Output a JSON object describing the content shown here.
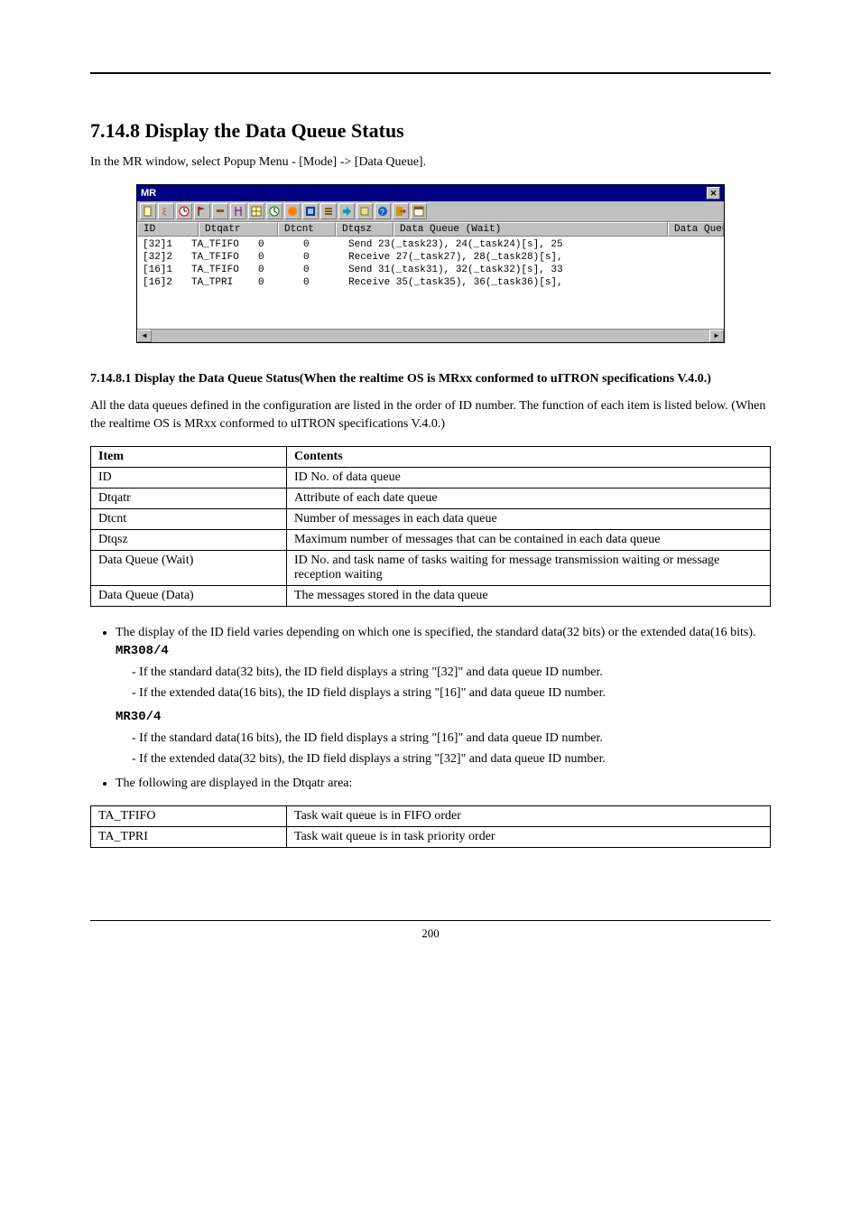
{
  "section_number": "7.14.8",
  "section_title": "Display the Data Queue Status",
  "intro_paragraph": "In the MR window, select Popup Menu - [Mode] -> [Data Queue].",
  "mr_window": {
    "title": "MR",
    "columns": [
      "ID",
      "Dtqatr",
      "Dtcnt",
      "Dtqsz",
      "Data Queue (Wait)",
      "Data Queue (Data)"
    ],
    "rows": [
      {
        "id": "[32]1",
        "attr": "TA_TFIFO",
        "dtcnt": "0",
        "dtqsz": "0",
        "wait": "Send 23(_task23), 24(_task24)[s], 25",
        "data": ""
      },
      {
        "id": "[32]2",
        "attr": "TA_TFIFO",
        "dtcnt": "0",
        "dtqsz": "0",
        "wait": "Receive 27(_task27), 28(_task28)[s],",
        "data": ""
      },
      {
        "id": "[16]1",
        "attr": "TA_TFIFO",
        "dtcnt": "0",
        "dtqsz": "0",
        "wait": "Send 31(_task31), 32(_task32)[s], 33",
        "data": ""
      },
      {
        "id": "[16]2",
        "attr": "TA_TPRI",
        "dtcnt": "0",
        "dtqsz": "0",
        "wait": "Receive 35(_task35), 36(_task36)[s],",
        "data": ""
      }
    ]
  },
  "subsection_number": "7.14.8.1",
  "subsection_title": "Display the Data Queue Status(When the realtime OS is MRxx conformed to uITRON specifications V.4.0.)",
  "subsection_para": "All the data queues defined in the configuration are listed in the order of ID number. The function of each item is listed below. (When the realtime OS is MRxx conformed to uITRON specifications V.4.0.)",
  "items_table": {
    "headers": [
      "Item",
      "Contents"
    ],
    "rows": [
      [
        "ID",
        "ID No. of data queue"
      ],
      [
        "Dtqatr",
        "Attribute of each date queue"
      ],
      [
        "Dtcnt",
        "Number of messages in each data queue"
      ],
      [
        "Dtqsz",
        "Maximum number of messages that can be contained in each data queue"
      ],
      [
        "Data Queue (Wait)",
        "ID No. and task name of tasks waiting for message transmission waiting or message reception waiting"
      ],
      [
        "Data Queue (Data)",
        "The messages stored in the data queue"
      ]
    ]
  },
  "bullet1_intro": "The display of the ID field varies depending on which one is specified, the standard data(32 bits) or the extended data(16 bits).",
  "mr308_label": "MR308/4",
  "mr308_items": [
    "If the standard data(32 bits), the ID field displays a string \"[32]\" and data queue ID number.",
    "If the extended data(16 bits), the ID field displays a string \"[16]\" and data queue ID number."
  ],
  "mr30_label": "MR30/4",
  "mr30_items": [
    "If the standard data(16 bits), the ID field displays a string \"[16]\" and data queue ID number.",
    "If the extended data(32 bits), the ID field displays a string \"[32]\" and data queue ID number."
  ],
  "bullet2_intro": "The following are displayed in the Dtqatr area:",
  "dtqatr_table": {
    "rows": [
      [
        "TA_TFIFO",
        "Task wait queue is in FIFO order"
      ],
      [
        "TA_TPRI",
        "Task wait queue is in task priority order"
      ]
    ]
  },
  "page_number": "200",
  "toolbar_icons": [
    "doc-icon",
    "dollar-icon",
    "clock-icon",
    "flag-icon",
    "flag2-icon",
    "fn-icon",
    "grid-icon",
    "clock2-icon",
    "amber-icon",
    "grid2-icon",
    "bars-icon",
    "arrows-icon",
    "blank-icon",
    "q-icon",
    "exit-icon",
    "window-icon"
  ]
}
